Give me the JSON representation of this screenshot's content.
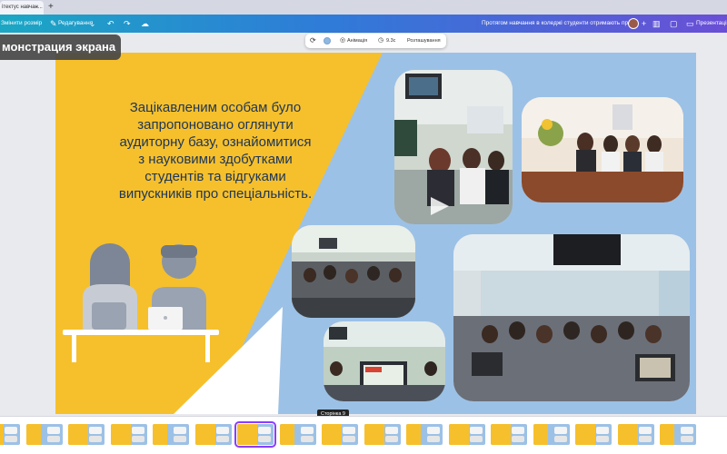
{
  "browser": {
    "tab_title": "ітектус навчан...",
    "tab_close": "×",
    "tab_add": "+"
  },
  "toolbar": {
    "resize_label": "Змінити розмір",
    "edit_label": "Редагування",
    "doc_title": "Протягом навчання в коледжі студенти отримають про...",
    "add_label": "+",
    "present_label": "Презентація"
  },
  "overlay": {
    "screen_share_label": "монстрация экрана"
  },
  "context_toolbar": {
    "animation_label": "Анімація",
    "duration_label": "9.3с",
    "position_label": "Розташування"
  },
  "slide": {
    "text_lines": [
      "Зацікавленим особам було",
      "запропоновано оглянути",
      "аудиторну базу, ознайомитися",
      "з науковими здобутками",
      "студентів та відгуками",
      "випускників про спеціальність."
    ]
  },
  "filmstrip": {
    "tooltip": "Сторінка 9",
    "active_index": 6,
    "count": 17
  },
  "colors": {
    "slide_background": "#9cc1e6",
    "yellow_panel": "#f6c02c",
    "text": "#1d3557",
    "accent": "#8b3dff"
  }
}
